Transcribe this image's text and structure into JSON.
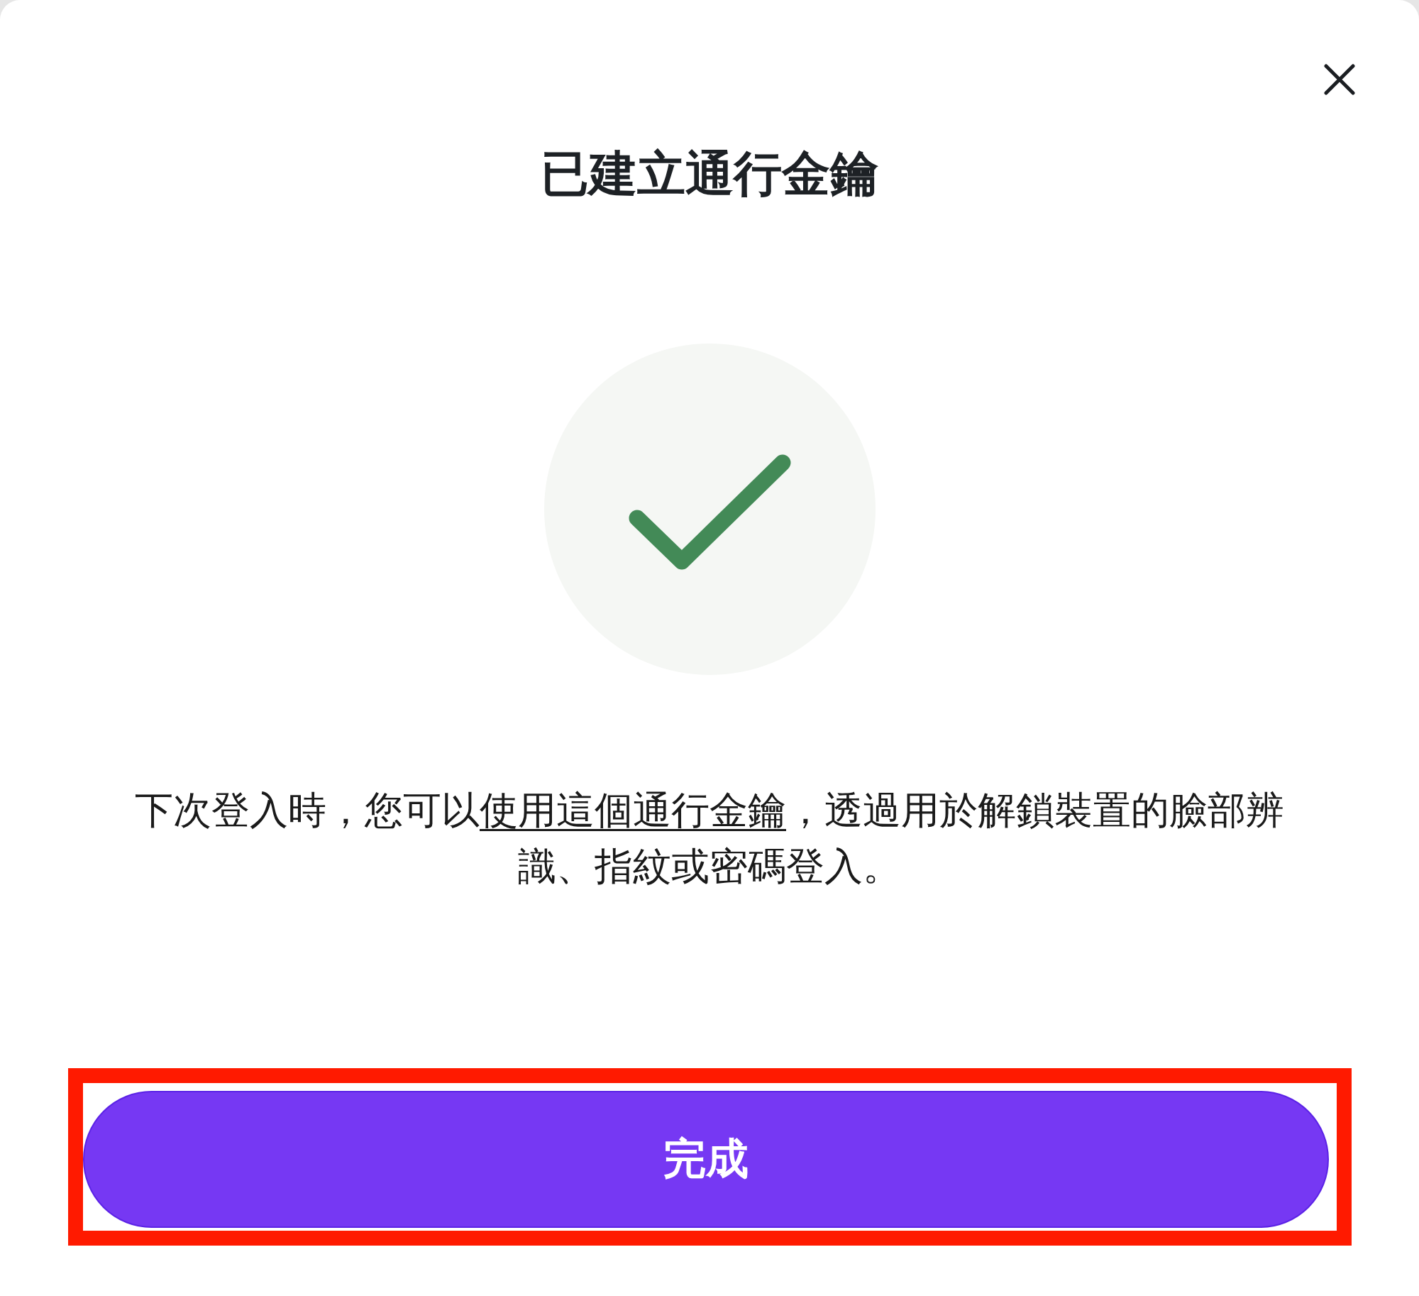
{
  "dialog": {
    "title": "已建立通行金鑰",
    "message": {
      "before": "下次登入時，您可以",
      "link": "使用這個通行金鑰",
      "after": "，透過用於解鎖裝置的臉部辨識、指紋或密碼登入。"
    },
    "done_button": {
      "label": "完成",
      "highlighted": true
    }
  }
}
